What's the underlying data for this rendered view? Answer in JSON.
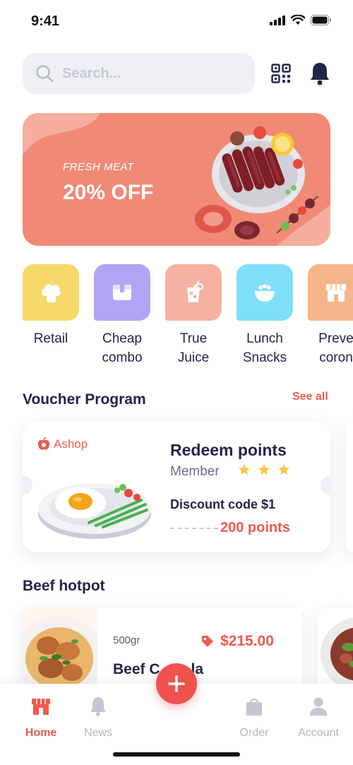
{
  "status_bar": {
    "time": "9:41"
  },
  "search": {
    "placeholder": "Search..."
  },
  "icons": {
    "search": "search-icon",
    "qr": "qr-code-icon",
    "bell": "bell-icon"
  },
  "banner": {
    "subtitle": "FRESH MEAT",
    "title": "20% OFF",
    "background": "#f08a76"
  },
  "categories": [
    {
      "label": "Retail",
      "icon": "chef-hat-icon",
      "color": "#f7d96b"
    },
    {
      "label": "Cheap\ncombo",
      "icon": "box-icon",
      "color": "#b3a3f4"
    },
    {
      "label": "True\nJuice",
      "icon": "juice-glass-icon",
      "color": "#f5b1a1"
    },
    {
      "label": "Lunch\nSnacks",
      "icon": "bowl-icon",
      "color": "#7fe0fb"
    },
    {
      "label": "Preve\ncoron",
      "icon": "store-icon",
      "color": "#f5b58a"
    }
  ],
  "voucher_section": {
    "title": "Voucher Program",
    "see_all": "See all"
  },
  "voucher": {
    "shop": "Ashop",
    "title": "Redeem points",
    "member": "Member",
    "stars": 3,
    "discount": "Discount code $1",
    "points": "200 points"
  },
  "product_section": {
    "title": "Beef hotpot"
  },
  "product": {
    "weight": "500gr",
    "price": "$215.00",
    "name": "Beef C",
    "name_tail": "la"
  },
  "nav": {
    "items": [
      {
        "label": "Home",
        "icon": "store-icon",
        "active": true
      },
      {
        "label": "News",
        "icon": "bell-icon",
        "active": false
      },
      {
        "label": "Order",
        "icon": "shopping-bag-icon",
        "active": false
      },
      {
        "label": "Account",
        "icon": "user-icon",
        "active": false
      }
    ]
  },
  "colors": {
    "accent": "#f05a4f",
    "text": "#22254a",
    "inactive": "#b3b6c3"
  }
}
